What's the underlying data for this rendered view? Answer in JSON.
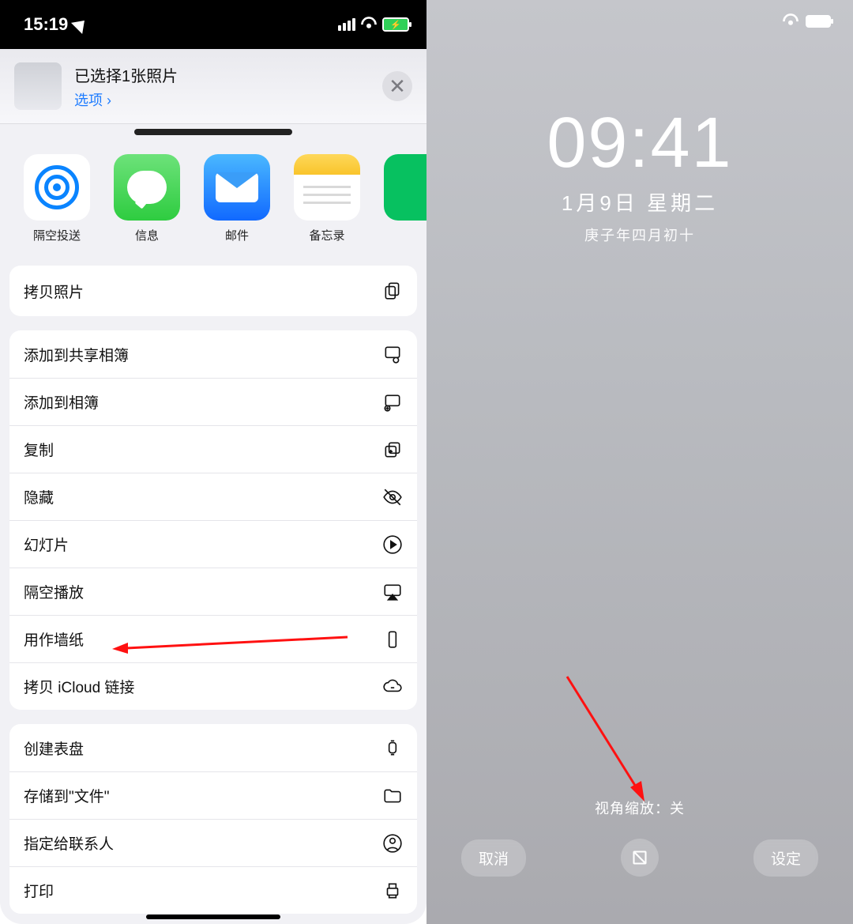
{
  "leftStatus": {
    "time": "15:19"
  },
  "shareHeader": {
    "title": "已选择1张照片",
    "options": "选项 ›"
  },
  "apps": {
    "airdrop": "隔空投送",
    "messages": "信息",
    "mail": "邮件",
    "notes": "备忘录"
  },
  "actionsTop": {
    "copyPhoto": "拷贝照片"
  },
  "actions": {
    "addShared": "添加到共享相簿",
    "addAlbum": "添加到相簿",
    "duplicate": "复制",
    "hide": "隐藏",
    "slideshow": "幻灯片",
    "airplay": "隔空播放",
    "wallpaper": "用作墙纸",
    "icloudLink": "拷贝 iCloud 链接"
  },
  "actions2": {
    "watchFace": "创建表盘",
    "saveFiles": "存储到\"文件\"",
    "assignContact": "指定给联系人",
    "print": "打印"
  },
  "right": {
    "clock": "09:41",
    "date": "1月9日 星期二",
    "lunar": "庚子年四月初十",
    "perspective": "视角缩放：关",
    "cancel": "取消",
    "set": "设定"
  }
}
